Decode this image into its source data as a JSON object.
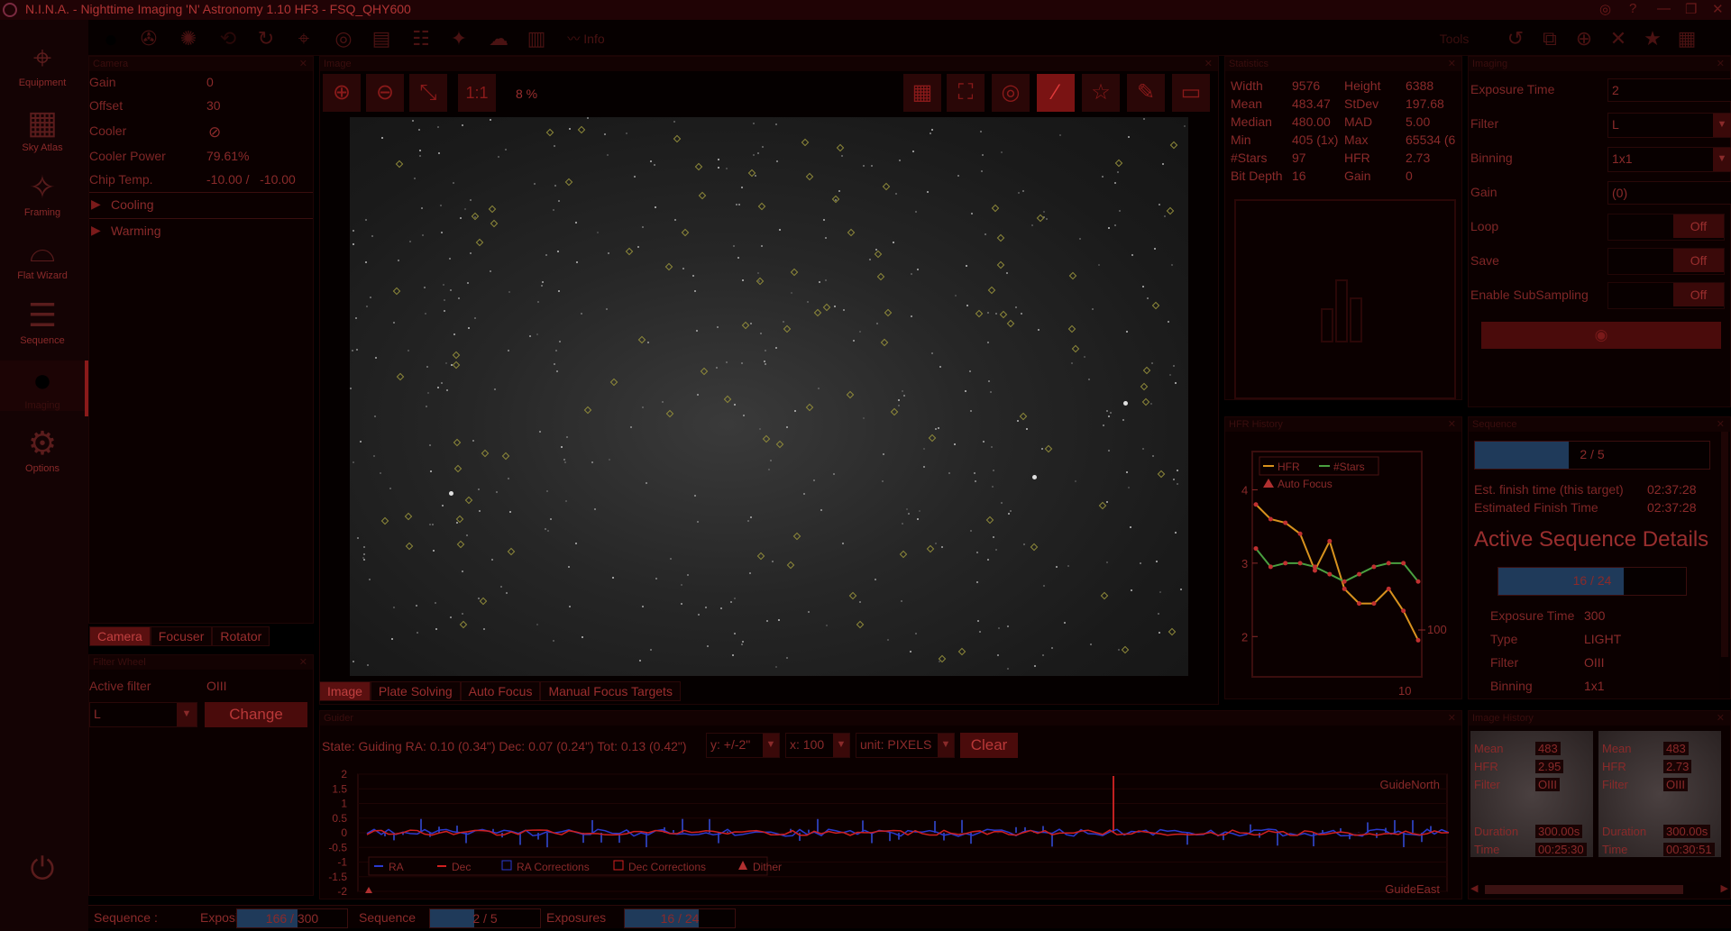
{
  "app": {
    "title": "N.I.N.A. - Nighttime Imaging 'N' Astronomy 1.10 HF3   -   FSQ_QHY600",
    "window_controls": [
      "◎",
      "?",
      "—",
      "❐",
      "✕"
    ]
  },
  "sidebar": {
    "items": [
      {
        "label": "Equipment",
        "icon": "telescope-icon"
      },
      {
        "label": "Sky Atlas",
        "icon": "map-icon"
      },
      {
        "label": "Framing",
        "icon": "framing-icon"
      },
      {
        "label": "Flat Wizard",
        "icon": "wizard-icon"
      },
      {
        "label": "Sequence",
        "icon": "list-icon"
      },
      {
        "label": "Imaging",
        "icon": "lens-icon"
      },
      {
        "label": "Options",
        "icon": "gear-icon"
      }
    ],
    "power_icon": "power-icon"
  },
  "toolbar": {
    "info_label": "Info",
    "tools_label": "Tools"
  },
  "camera_panel": {
    "header": "Camera",
    "rows": [
      {
        "label": "Gain",
        "value": "0"
      },
      {
        "label": "Offset",
        "value": "30"
      },
      {
        "label": "Cooler",
        "value": "⊘"
      },
      {
        "label": "Cooler Power",
        "value": "79.61%"
      },
      {
        "label": "Chip Temp.",
        "value": "-10.00 /   -10.00"
      }
    ],
    "expanders": [
      "Cooling",
      "Warming"
    ],
    "tabs": [
      "Camera",
      "Focuser",
      "Rotator"
    ]
  },
  "filter_panel": {
    "header": "Filter Wheel",
    "active_filter_label": "Active filter",
    "active_filter_value": "OIII",
    "select_value": "L",
    "change_label": "Change"
  },
  "image_panel": {
    "header": "Image",
    "zoom_text": "8 %",
    "one_to_one": "1:1",
    "tabs": [
      "Image",
      "Plate Solving",
      "Auto Focus",
      "Manual Focus Targets"
    ]
  },
  "statistics": {
    "header": "Statistics",
    "rows": [
      {
        "l1": "Width",
        "v1": "9576",
        "l2": "Height",
        "v2": "6388"
      },
      {
        "l1": "Mean",
        "v1": "483.47",
        "l2": "StDev",
        "v2": "197.68"
      },
      {
        "l1": "Median",
        "v1": "480.00",
        "l2": "MAD",
        "v2": "5.00"
      },
      {
        "l1": "Min",
        "v1": "405 (1x)",
        "l2": "Max",
        "v2": "65534 (6"
      },
      {
        "l1": "#Stars",
        "v1": "97",
        "l2": "HFR",
        "v2": "2.73"
      },
      {
        "l1": "Bit Depth",
        "v1": "16",
        "l2": "Gain",
        "v2": "0"
      }
    ]
  },
  "imaging": {
    "header": "Imaging",
    "exposure_label": "Exposure Time",
    "exposure_value": "2",
    "filter_label": "Filter",
    "filter_value": "L",
    "binning_label": "Binning",
    "binning_value": "1x1",
    "gain_label": "Gain",
    "gain_value": "(0)",
    "loop_label": "Loop",
    "save_label": "Save",
    "subsampling_label": "Enable SubSampling",
    "off_label": "Off"
  },
  "hfr_history": {
    "header": "HFR History",
    "legend": [
      "HFR",
      "#Stars",
      "Auto Focus"
    ]
  },
  "sequence_panel": {
    "header": "Sequence",
    "progress_label": "2 / 5",
    "progress_fraction": 0.4,
    "est_target_label": "Est. finish time (this target)",
    "est_target_value": "02:37:28",
    "est_total_label": "Estimated Finish Time",
    "est_total_value": "02:37:28",
    "active_title": "Active Sequence Details",
    "exposures_label": "16 / 24",
    "exposures_fraction": 0.6667,
    "rows": [
      {
        "label": "Exposure Time",
        "value": "300"
      },
      {
        "label": "Type",
        "value": "LIGHT"
      },
      {
        "label": "Filter",
        "value": "OIII"
      },
      {
        "label": "Binning",
        "value": "1x1"
      }
    ]
  },
  "guider": {
    "header": "Guider",
    "state": "State: Guiding  RA: 0.10 (0.34\")  Dec: 0.07 (0.24\")  Tot: 0.13 (0.42\")",
    "y_select": "y: +/-2\"",
    "x_select": "x: 100",
    "unit_select": "unit: PIXELS",
    "clear_label": "Clear",
    "north_label": "GuideNorth",
    "east_label": "GuideEast",
    "legend": [
      "RA",
      "Dec",
      "RA Corrections",
      "Dec Corrections",
      "Dither"
    ]
  },
  "image_history": {
    "header": "Image History",
    "items": [
      {
        "mean": "483",
        "hfr": "2.95",
        "filter": "OIII",
        "duration": "300.00s",
        "time": "00:25:30"
      },
      {
        "mean": "483",
        "hfr": "2.73",
        "filter": "OIII",
        "duration": "300.00s",
        "time": "00:30:51"
      }
    ],
    "labels": {
      "mean": "Mean",
      "hfr": "HFR",
      "filter": "Filter",
      "duration": "Duration",
      "time": "Time"
    }
  },
  "statusbar": {
    "sequence_label": "Sequence :",
    "exposing_label": "Exposing",
    "exposing_value": "166 / 300",
    "exposing_fraction": 0.55,
    "sequence2_label": "Sequence",
    "sequence2_value": "2 / 5",
    "sequence2_fraction": 0.4,
    "exposures_label": "Exposures",
    "exposures_value": "16 / 24",
    "exposures_fraction": 0.67
  },
  "chart_data": {
    "type": "line",
    "title": "",
    "xlabel": "",
    "ylabel": "",
    "x": [
      1,
      2,
      3,
      4,
      5,
      6,
      7,
      8,
      9,
      10,
      11,
      12
    ],
    "ylim": [
      1.5,
      4.3
    ],
    "y2_tick": "100",
    "x_tick": "10",
    "y_ticks": [
      "4",
      "3",
      "2"
    ],
    "series": [
      {
        "name": "HFR",
        "values": [
          3.8,
          3.6,
          3.55,
          3.4,
          2.9,
          3.3,
          2.65,
          2.45,
          2.45,
          2.65,
          2.35,
          1.95
        ],
        "color": "#d8921e"
      },
      {
        "name": "#Stars",
        "values": [
          3.2,
          2.95,
          3.0,
          3.0,
          2.95,
          2.85,
          2.75,
          2.85,
          2.95,
          3.0,
          3.0,
          2.75
        ],
        "color": "#4aa040"
      }
    ]
  }
}
